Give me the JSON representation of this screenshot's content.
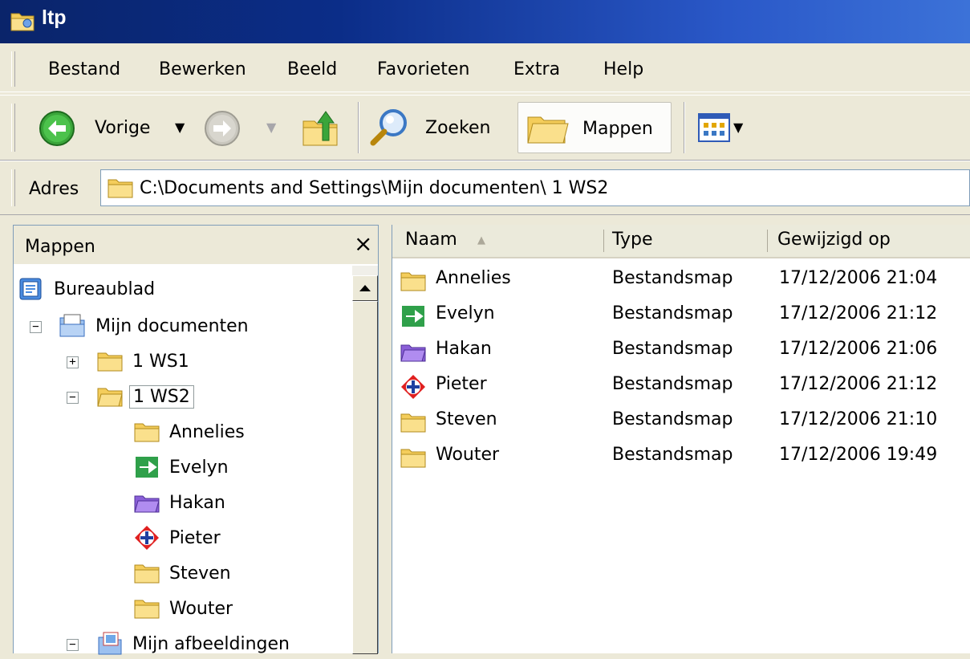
{
  "window": {
    "title": "ltp"
  },
  "menu": {
    "items": [
      "Bestand",
      "Bewerken",
      "Beeld",
      "Favorieten",
      "Extra",
      "Help"
    ]
  },
  "toolbar": {
    "back_label": "Vorige",
    "search_label": "Zoeken",
    "folders_label": "Mappen"
  },
  "address": {
    "label": "Adres",
    "value": "C:\\Documents and Settings\\Mijn documenten\\ 1 WS2"
  },
  "folderpane": {
    "title": "Mappen",
    "close_glyph": "×",
    "tree": [
      {
        "label": "Bureaublad",
        "icon": "desktop-icon",
        "expander": null
      },
      {
        "label": "Mijn documenten",
        "icon": "my-documents-icon",
        "expander": "−"
      },
      {
        "label": "1 WS1",
        "icon": "folder-icon",
        "expander": "+"
      },
      {
        "label": "1 WS2",
        "icon": "folder-open-icon",
        "expander": "−",
        "selected": true
      },
      {
        "label": "Annelies",
        "icon": "folder-icon"
      },
      {
        "label": "Evelyn",
        "icon": "green-arrow-icon"
      },
      {
        "label": "Hakan",
        "icon": "purple-folder-icon"
      },
      {
        "label": "Pieter",
        "icon": "red-cross-icon"
      },
      {
        "label": "Steven",
        "icon": "folder-icon"
      },
      {
        "label": "Wouter",
        "icon": "folder-icon"
      },
      {
        "label": "Mijn afbeeldingen",
        "icon": "my-pictures-icon",
        "expander": "−"
      }
    ]
  },
  "list": {
    "columns": [
      "Naam",
      "Type",
      "Gewijzigd op"
    ],
    "sort_glyph": "▲",
    "rows": [
      {
        "name": "Annelies",
        "type": "Bestandsmap",
        "modified": "17/12/2006 21:04",
        "icon": "folder-icon"
      },
      {
        "name": "Evelyn",
        "type": "Bestandsmap",
        "modified": "17/12/2006 21:12",
        "icon": "green-arrow-icon"
      },
      {
        "name": "Hakan",
        "type": "Bestandsmap",
        "modified": "17/12/2006 21:06",
        "icon": "purple-folder-icon"
      },
      {
        "name": "Pieter",
        "type": "Bestandsmap",
        "modified": "17/12/2006 21:12",
        "icon": "red-cross-icon"
      },
      {
        "name": "Steven",
        "type": "Bestandsmap",
        "modified": "17/12/2006 21:10",
        "icon": "folder-icon"
      },
      {
        "name": "Wouter",
        "type": "Bestandsmap",
        "modified": "17/12/2006 19:49",
        "icon": "folder-icon"
      }
    ]
  },
  "colors": {
    "titlebar": "#0A246A",
    "chrome": "#ECE9D8",
    "folder": "#F1C85A"
  }
}
